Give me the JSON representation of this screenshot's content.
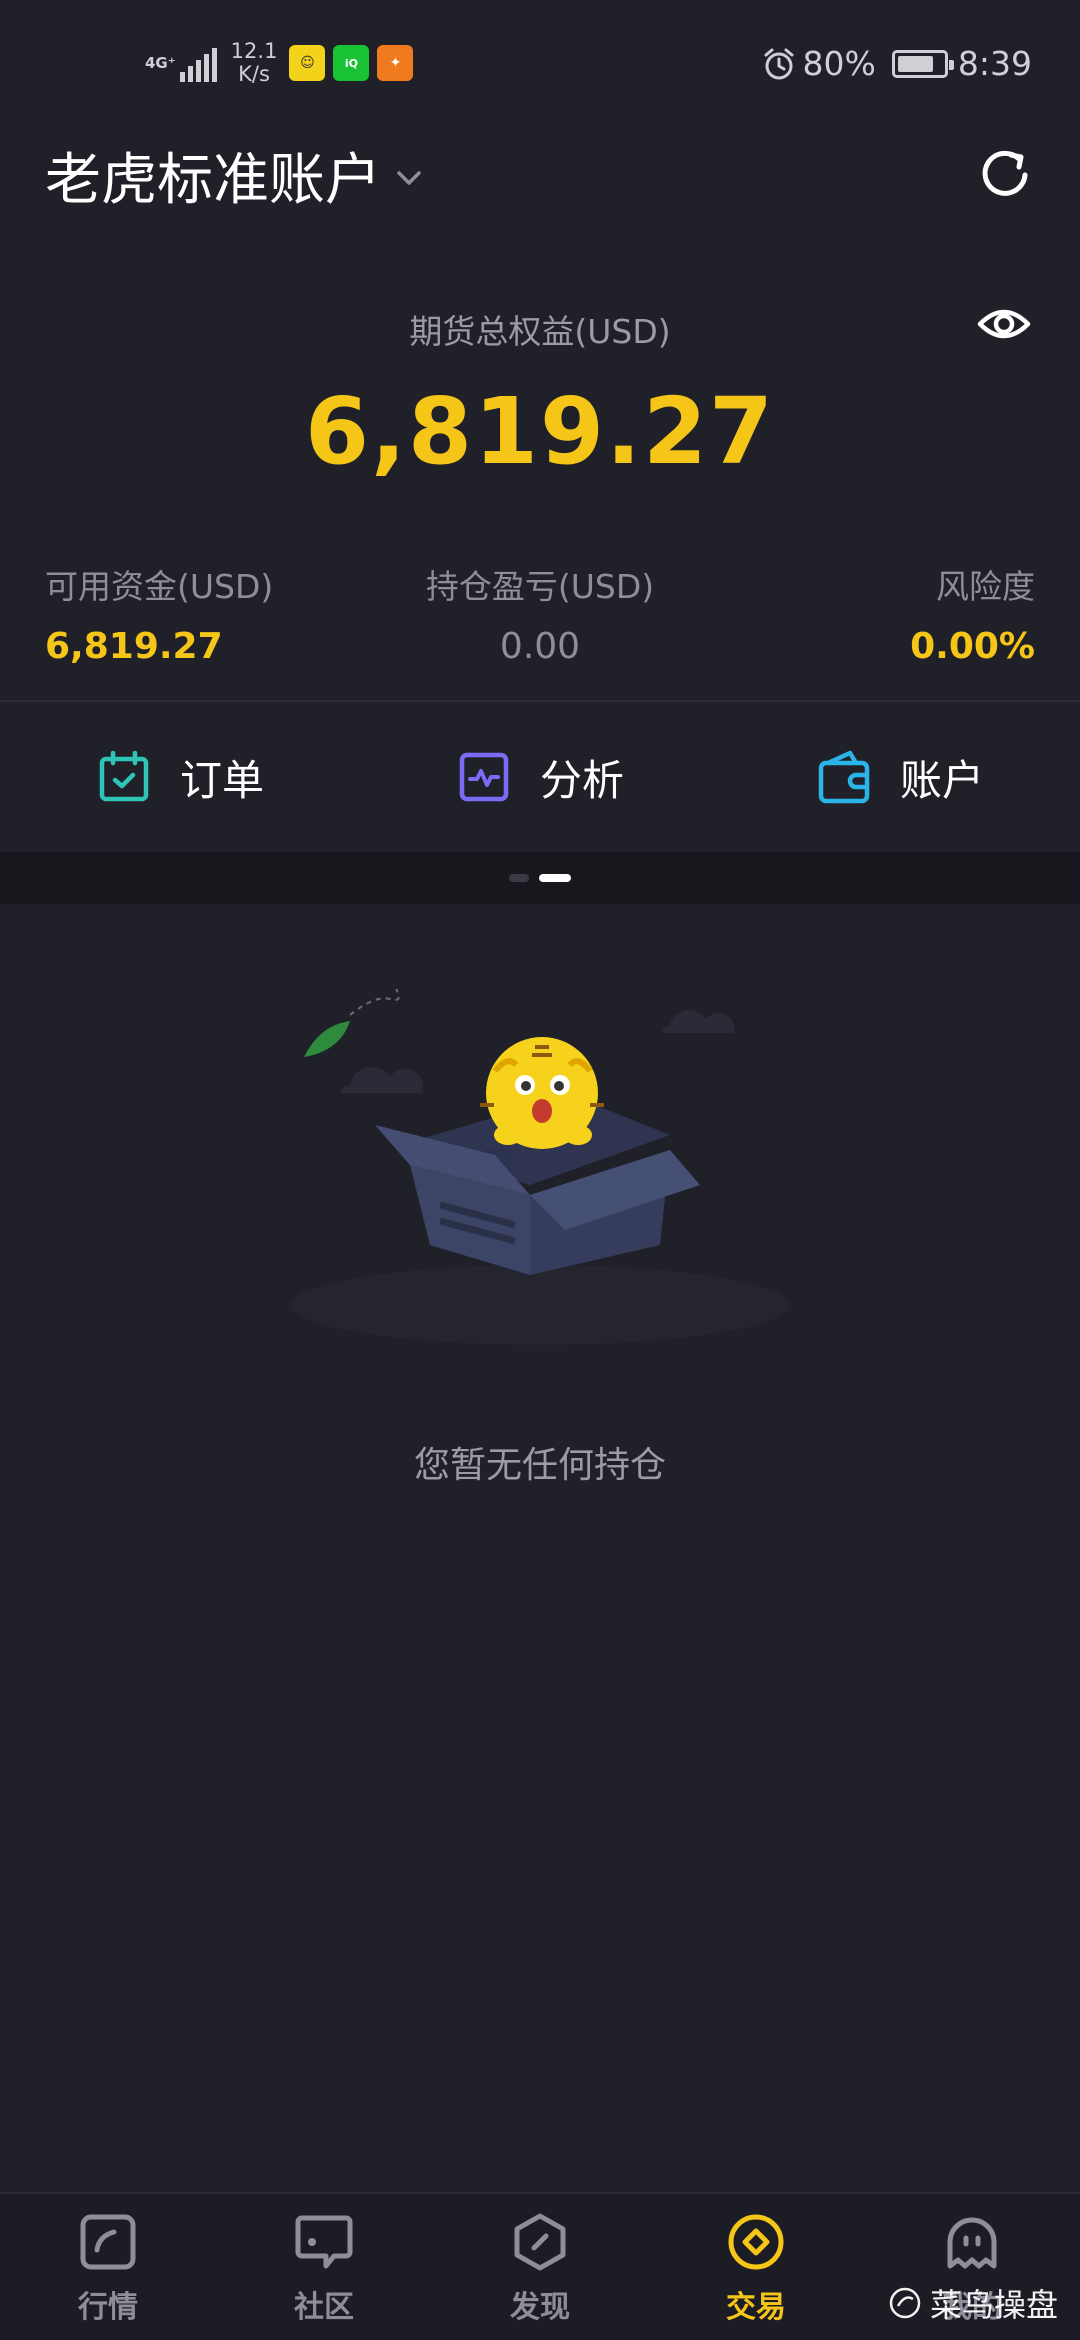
{
  "status_bar": {
    "network": "4G⁺",
    "speed_value": "12.1",
    "speed_unit": "K/s",
    "battery": "80%",
    "battery_level": 0.8,
    "time": "8:39",
    "icons": [
      "signal-icon",
      "smiley-app-icon",
      "iqiyi-app-icon",
      "orange-app-icon",
      "alarm-icon",
      "battery-icon"
    ]
  },
  "header": {
    "account_name": "老虎标准账户",
    "icons": [
      "chevron-down-icon",
      "refresh-icon"
    ]
  },
  "equity": {
    "label": "期货总权益(USD)",
    "value": "6,819.27"
  },
  "stats": {
    "available": {
      "label": "可用资金(USD)",
      "value": "6,819.27"
    },
    "pnl": {
      "label": "持仓盈亏(USD)",
      "value": "0.00"
    },
    "risk": {
      "label": "风险度",
      "value": "0.00%"
    }
  },
  "quick_menu": [
    {
      "label": "订单",
      "icon": "calendar-check-icon",
      "color": "#2ec4b6"
    },
    {
      "label": "分析",
      "icon": "analysis-chart-icon",
      "color": "#7b6cf6"
    },
    {
      "label": "账户",
      "icon": "wallet-icon",
      "color": "#2ab4e8"
    }
  ],
  "pager": {
    "count": 2,
    "active_index": 1
  },
  "empty_state": {
    "text": "您暂无任何持仓"
  },
  "bottom_nav": [
    {
      "label": "行情",
      "icon": "market-icon"
    },
    {
      "label": "社区",
      "icon": "community-icon"
    },
    {
      "label": "发现",
      "icon": "discover-icon"
    },
    {
      "label": "交易",
      "icon": "trade-icon",
      "active": true
    },
    {
      "label": "我的",
      "icon": "profile-icon"
    }
  ],
  "watermark": "菜鸟操盘",
  "colors": {
    "background": "#202029",
    "accent_yellow": "#f5c518",
    "muted": "#8d8e99"
  }
}
